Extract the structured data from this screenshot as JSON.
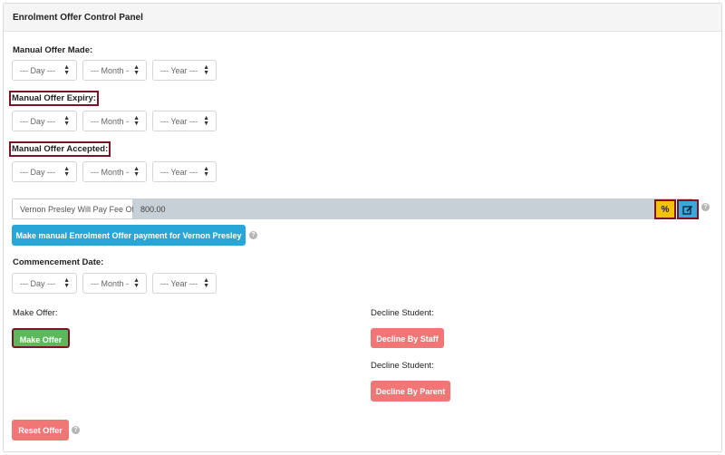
{
  "panel": {
    "title": "Enrolment Offer Control Panel"
  },
  "date_fields": {
    "day_placeholder": "--- Day ---",
    "month_placeholder": "--- Month -",
    "year_placeholder": "--- Year ---"
  },
  "manual_offer_made": {
    "label": "Manual Offer Made:"
  },
  "manual_offer_expiry": {
    "label": "Manual Offer Expiry:"
  },
  "manual_offer_accepted": {
    "label": "Manual Offer Accepted:"
  },
  "fee": {
    "label": "Vernon Presley Will Pay Fee Of",
    "value": "800.00",
    "percent_button": "%",
    "help": "?"
  },
  "manual_payment_button": "Make manual Enrolment Offer payment for Vernon Presley",
  "commencement_date": {
    "label": "Commencement Date:"
  },
  "make_offer": {
    "label": "Make Offer:",
    "button": "Make Offer"
  },
  "decline_staff": {
    "label": "Decline Student:",
    "button": "Decline By Staff"
  },
  "decline_parent": {
    "label": "Decline Student:",
    "button": "Decline By Parent"
  },
  "reset": {
    "button": "Reset Offer"
  },
  "colors": {
    "header_bg": "#f5f5f5",
    "highlight_border": "#7a1426",
    "primary_blue": "#27a6d8",
    "success_green": "#5cb85c",
    "danger_red": "#f17676",
    "warning_yellow": "#f2c20d"
  },
  "icons": {
    "percent": "percent-icon",
    "edit": "edit-icon",
    "help": "help-icon",
    "caret": "sort-caret-icon"
  }
}
